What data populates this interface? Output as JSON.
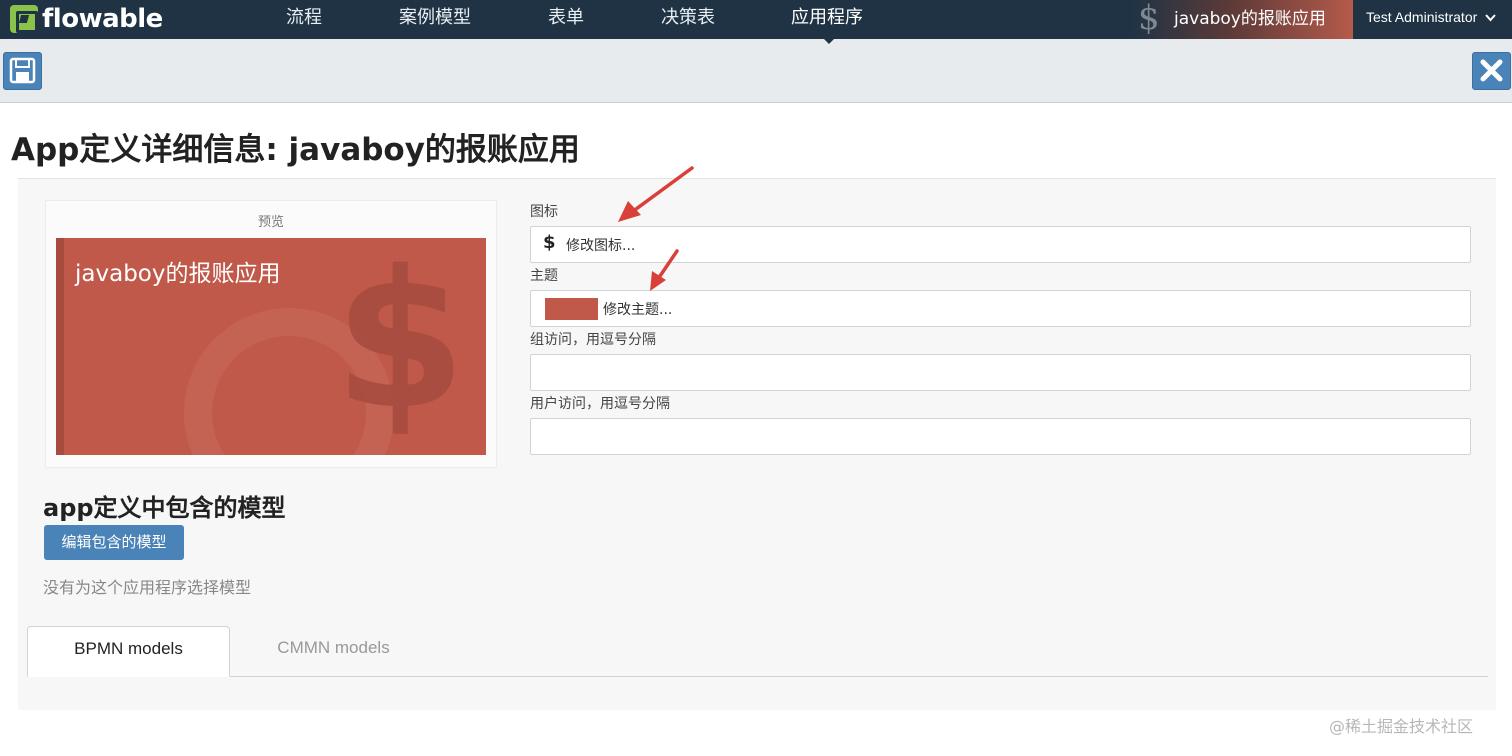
{
  "navbar": {
    "brand": "flowable",
    "items": [
      {
        "label": "流程"
      },
      {
        "label": "案例模型"
      },
      {
        "label": "表单"
      },
      {
        "label": "决策表"
      },
      {
        "label": "应用程序"
      }
    ],
    "active_app": "javaboy的报账应用",
    "app_icon_glyph": "$",
    "user": "Test Administrator",
    "user_chevron": "❯"
  },
  "toolbar": {
    "save_icon": "save-icon",
    "close_icon": "close-icon"
  },
  "page": {
    "title": "App定义详细信息: javaboy的报账应用"
  },
  "preview": {
    "label": "预览",
    "card_title": "javaboy的报账应用",
    "card_glyph": "$",
    "theme_color": "#c0594a"
  },
  "form": {
    "icon_label": "图标",
    "icon_glyph": "$",
    "icon_value": "修改图标...",
    "theme_label": "主题",
    "theme_value": "修改主题...",
    "group_access_label": "组访问，用逗号分隔",
    "group_access_value": "",
    "user_access_label": "用户访问，用逗号分隔",
    "user_access_value": ""
  },
  "models": {
    "heading": "app定义中包含的模型",
    "edit_button": "编辑包含的模型",
    "empty_note": "没有为这个应用程序选择模型"
  },
  "tabs": [
    {
      "label": "BPMN models"
    },
    {
      "label": "CMMN models"
    }
  ],
  "watermark": "@稀土掘金技术社区",
  "colors": {
    "navbar": "#1f3345",
    "accent_button": "#4a83b8",
    "annotation_arrow": "#d9403a"
  }
}
